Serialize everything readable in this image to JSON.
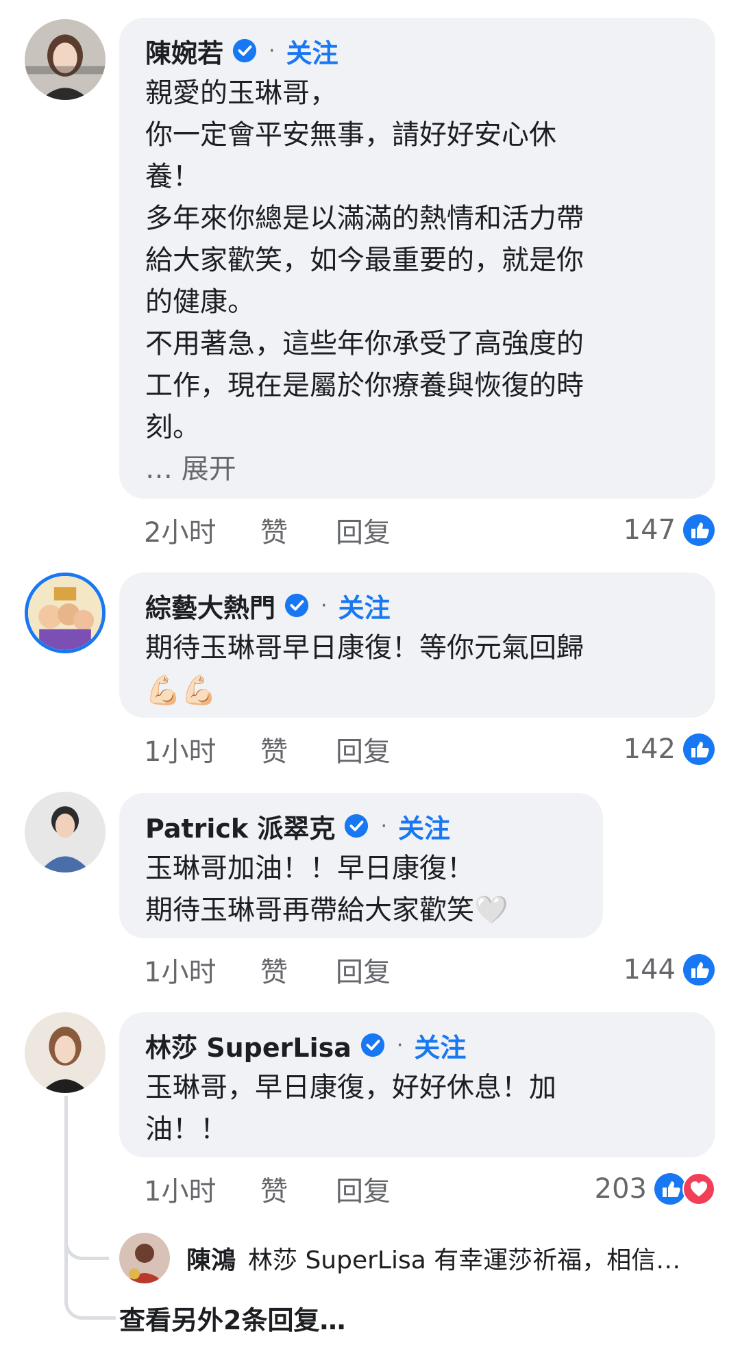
{
  "comments": [
    {
      "author": "陳婉若",
      "follow_label": "关注",
      "separator": "·",
      "text": "親愛的玉琳哥，\n你一定會平安無事，請好好安心休\n養！\n多年來你總是以滿滿的熱情和活力帶\n給大家歡笑，如今最重要的，就是你\n的健康。\n不用著急，這些年你承受了高強度的\n工作，現在是屬於你療養與恢復的時\n刻。",
      "expand_label": "… 展开",
      "time": "2小时",
      "like_label": "赞",
      "reply_label": "回复",
      "reaction_count": "147",
      "reactions": [
        "like-icon"
      ]
    },
    {
      "author": "綜藝大熱門",
      "follow_label": "关注",
      "separator": "·",
      "text": "期待玉琳哥早日康復！等你元氣回歸",
      "emoji": "💪🏻💪🏻",
      "time": "1小时",
      "like_label": "赞",
      "reply_label": "回复",
      "reaction_count": "142",
      "reactions": [
        "like-icon"
      ]
    },
    {
      "author": "Patrick 派翠克",
      "follow_label": "关注",
      "separator": "·",
      "text": "玉琳哥加油！！早日康復！\n期待玉琳哥再帶給大家歡笑🤍",
      "time": "1小时",
      "like_label": "赞",
      "reply_label": "回复",
      "reaction_count": "144",
      "reactions": [
        "like-icon"
      ]
    },
    {
      "author": "林莎 SuperLisa",
      "follow_label": "关注",
      "separator": "·",
      "text": "玉琳哥，早日康復，好好休息！加\n油！！",
      "time": "1小时",
      "like_label": "赞",
      "reply_label": "回复",
      "reaction_count": "203",
      "reactions": [
        "like-icon",
        "love-icon"
      ]
    }
  ],
  "reply_preview": {
    "author": "陳鴻",
    "text": "林莎 SuperLisa 有幸運莎祈福，相信…"
  },
  "more_replies_label": "查看另外2条回复…",
  "colors": {
    "bubble": "#f0f2f5",
    "accent": "#1877f2",
    "love": "#f33e58",
    "secondary_text": "#65676b"
  }
}
